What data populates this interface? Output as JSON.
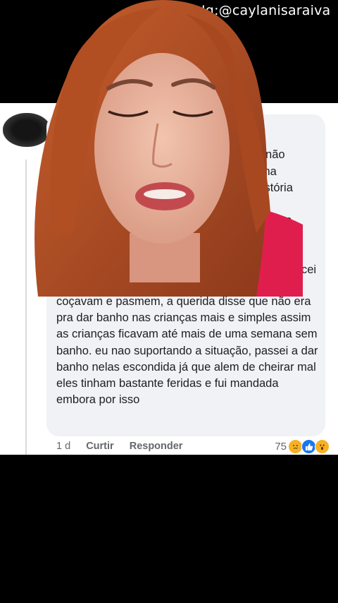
{
  "watermark": "Ig:@caylanisaraiva",
  "comment": {
    "visible_fragments": [
      "ãe que não",
      "bem uma",
      "uma história",
      "a com a",
      "cei"
    ],
    "body": "coçavam e pasmem, a querida disse que não era pra dar banho nas crianças mais e simples assim as crianças ficavam até mais de uma semana sem banho. eu nao suportando a situação, passei a dar banho nelas escondida já que alem de cheirar mal eles tinham bastante feridas e fui mandada embora por isso",
    "time": "1 d",
    "like_label": "Curtir",
    "reply_label": "Responder",
    "reaction_count": "75"
  },
  "colors": {
    "bubble": "#f0f2f5",
    "meta_text": "#65676b",
    "like_blue": "#1877f2",
    "hair": "#b8542a",
    "shirt": "#e01e4e"
  },
  "icons": [
    "sad-reaction-icon",
    "like-reaction-icon",
    "wow-reaction-icon"
  ]
}
